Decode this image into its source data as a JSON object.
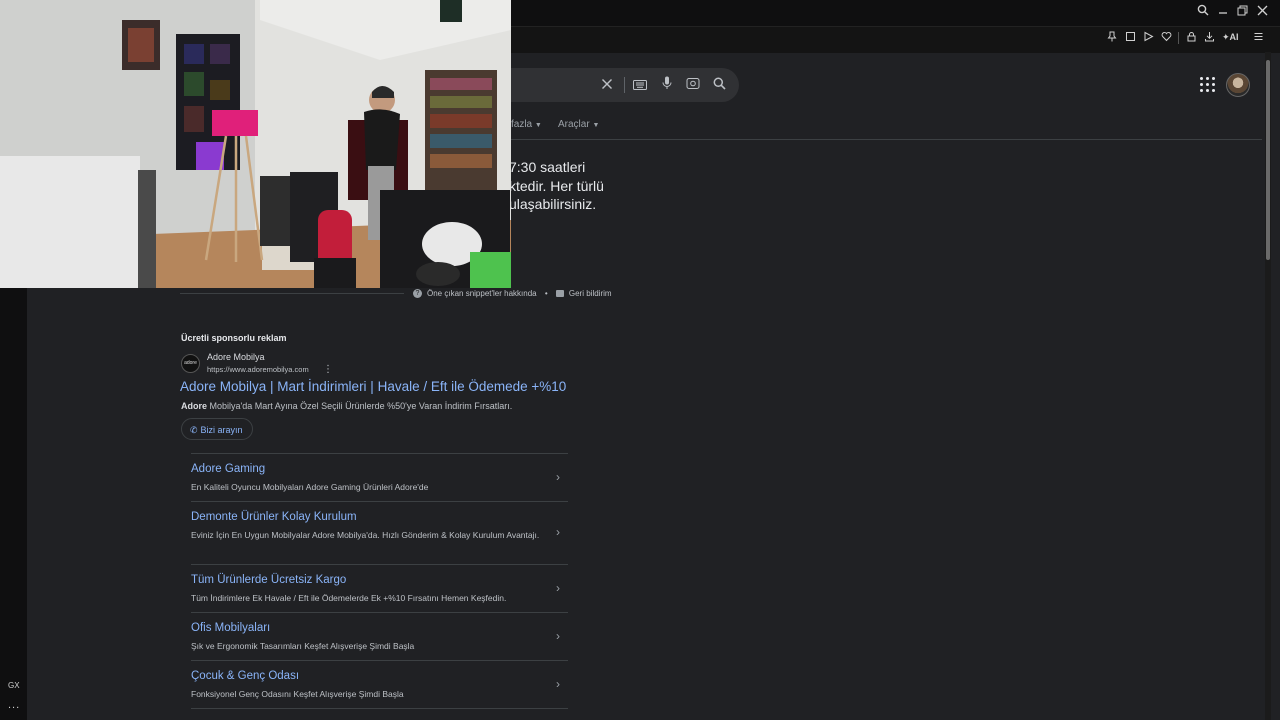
{
  "browser": {
    "window_controls": [
      "search-icon",
      "minimize-icon",
      "restore-icon",
      "close-icon"
    ],
    "toolbar_icons": [
      "pin-icon",
      "snapshot-icon",
      "play-icon",
      "heart-icon",
      "lock-icon",
      "download-icon",
      "ai-icon",
      "menu-icon"
    ],
    "ai_label": "AI",
    "sidebar": {
      "gx_label": "GX",
      "more_label": "..."
    }
  },
  "search": {
    "tabs": {
      "more": "Daha fazla",
      "tools": "Araçlar"
    },
    "more_visible": "fazla"
  },
  "featured_snippet": {
    "lines_visible": [
      "7:30 saatleri",
      "ktedir. Her türlü",
      "ulaşabilirsiniz."
    ],
    "about_label": "Öne çıkan snippet'ler hakkında",
    "feedback_label": "Geri bildirim"
  },
  "ad": {
    "label": "Ücretli sponsorlu reklam",
    "favicon_text": "adore",
    "site_name": "Adore Mobilya",
    "url": "https://www.adoremobilya.com",
    "title": "Adore Mobilya | Mart İndirimleri | Havale / Eft ile Ödemede +%10",
    "desc_bold": "Adore",
    "desc_rest": " Mobilya'da Mart Ayına Özel Seçili Ürünlerde %50'ye Varan İndirim Fırsatları.",
    "call_label": "Bizi arayın",
    "sitelinks": [
      {
        "title": "Adore Gaming",
        "desc": "En Kaliteli Oyuncu Mobilyaları Adore Gaming Ürünleri Adore'de"
      },
      {
        "title": "Demonte Ürünler Kolay Kurulum",
        "desc": "Eviniz İçin En Uygun Mobilyalar Adore Mobilya'da. Hızlı Gönderim & Kolay Kurulum Avantajı."
      },
      {
        "title": "Tüm Ürünlerde Ücretsiz Kargo",
        "desc": "Tüm İndirimlere Ek Havale / Eft ile Ödemelerde Ek +%10 Fırsatını Hemen Keşfedin."
      },
      {
        "title": "Ofis Mobilyaları",
        "desc": "Şık ve Ergonomik Tasarımları Keşfet Alışverişe Şimdi Başla"
      },
      {
        "title": "Çocuk & Genç Odası",
        "desc": "Fonksiyonel Genç Odasını Keşfet Alışverişe Şimdi Başla"
      }
    ]
  },
  "colors": {
    "background": "#202124",
    "link": "#8ab4f8",
    "text": "#bdc1c6",
    "chrome": "#0f0f10"
  }
}
